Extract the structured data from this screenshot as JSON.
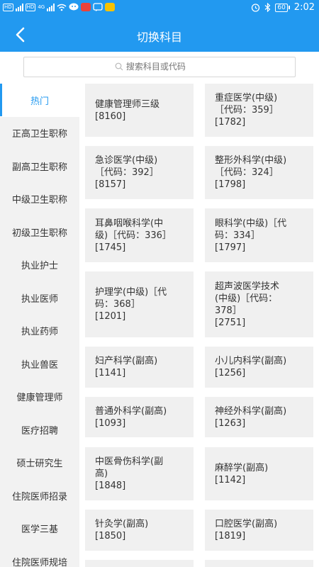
{
  "status_bar": {
    "time": "2:02",
    "battery": "60",
    "network": "4G",
    "sim_badges": [
      "HD",
      "HD"
    ]
  },
  "header": {
    "title": "切换科目",
    "back_icon": "chevron-left-icon"
  },
  "search": {
    "placeholder": "搜索科目或代码"
  },
  "sidebar": {
    "items": [
      {
        "label": "热门",
        "active": true
      },
      {
        "label": "正高卫生职称"
      },
      {
        "label": "副高卫生职称"
      },
      {
        "label": "中级卫生职称"
      },
      {
        "label": "初级卫生职称"
      },
      {
        "label": "执业护士"
      },
      {
        "label": "执业医师"
      },
      {
        "label": "执业药师"
      },
      {
        "label": "执业兽医"
      },
      {
        "label": "健康管理师"
      },
      {
        "label": "医疗招聘"
      },
      {
        "label": "硕士研究生"
      },
      {
        "label": "住院医师招录"
      },
      {
        "label": "医学三基"
      },
      {
        "label": "住院医师规培"
      }
    ]
  },
  "subjects": [
    {
      "label": "健康管理师三级\n[8160]"
    },
    {
      "label": "重症医学(中级)\n［代码：359］\n[1782]"
    },
    {
      "label": "急诊医学(中级)\n［代码：392］\n[8157]"
    },
    {
      "label": "整形外科学(中级)\n［代码：324］\n[1798]"
    },
    {
      "label": "耳鼻咽喉科学(中\n级)［代码：336］\n[1745]"
    },
    {
      "label": "眼科学(中级)［代\n码：334］\n[1797]"
    },
    {
      "label": "护理学(中级)［代\n码：368］\n[1201]"
    },
    {
      "label": "超声波医学技术\n(中级)［代码：\n378］\n[2751]"
    },
    {
      "label": "妇产科学(副高)\n[1141]"
    },
    {
      "label": "小儿内科学(副高)\n[1256]"
    },
    {
      "label": "普通外科学(副高)\n[1093]"
    },
    {
      "label": "神经外科学(副高)\n[1263]"
    },
    {
      "label": "中医骨伤科学(副\n高)\n[1848]"
    },
    {
      "label": "麻醉学(副高)\n[1142]"
    },
    {
      "label": "针灸学(副高)\n[1850]"
    },
    {
      "label": "口腔医学(副高)\n[1819]"
    }
  ],
  "colors": {
    "accent": "#2299f0",
    "sidebar_bg": "#f2f2f2",
    "card_bg": "#f0f0f0"
  }
}
